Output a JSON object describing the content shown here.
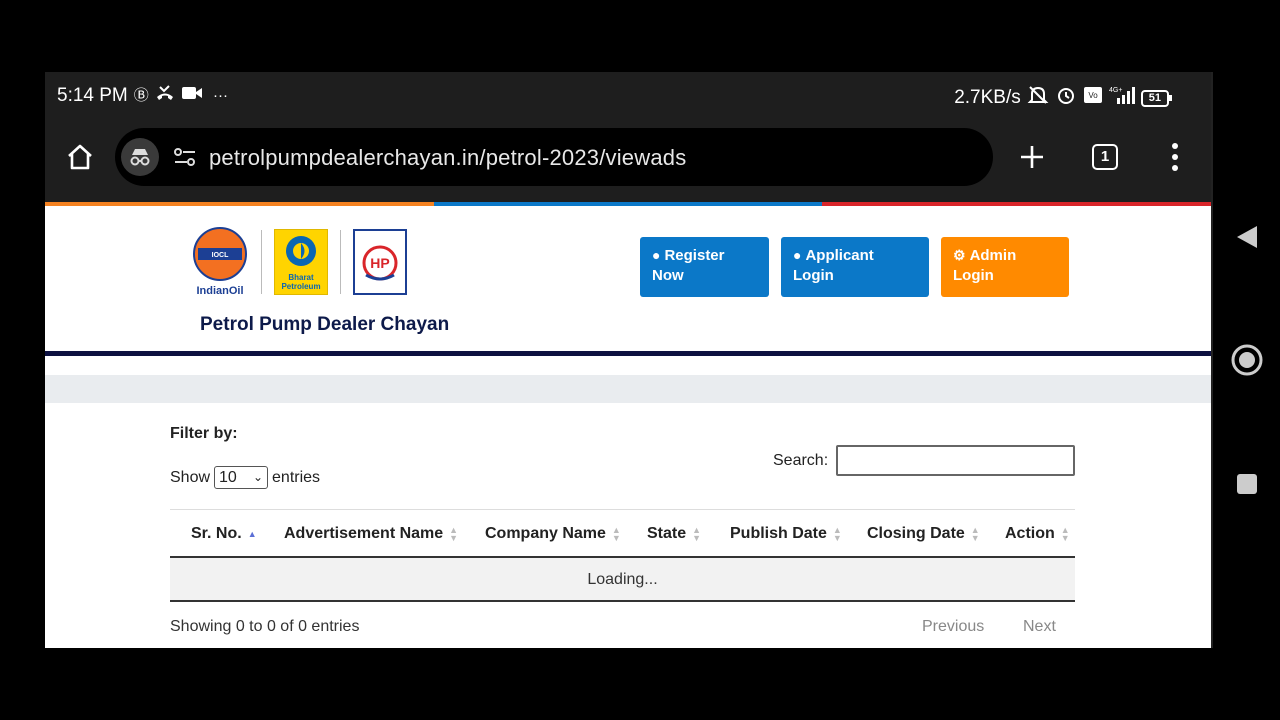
{
  "status_bar": {
    "time": "5:14 PM",
    "network_speed": "2.7KB/s",
    "battery": "51",
    "icons_left": [
      "b-circle-icon",
      "missed-call-icon",
      "video-icon",
      "more-dots-icon"
    ],
    "icons_right": [
      "mute-icon",
      "alarm-icon",
      "volte-icon",
      "signal-4g-icon",
      "battery-icon"
    ]
  },
  "browser": {
    "url": "petrolpumpdealerchayan.in/petrol-2023/viewads",
    "tab_count": "1"
  },
  "header": {
    "site_title": "Petrol Pump Dealer Chayan",
    "logos": {
      "indianoil_caption": "IndianOil",
      "bharat_line1": "Bharat",
      "bharat_line2": "Petroleum",
      "hp_text": "HP"
    },
    "buttons": [
      {
        "line1": "Register",
        "line2": "Now",
        "color": "#0b78c8"
      },
      {
        "line1": "Applicant",
        "line2": "Login",
        "color": "#0b78c8"
      },
      {
        "line1": "Admin",
        "line2": "Login",
        "color": "#ff8a00"
      }
    ],
    "tricolor": [
      "#f58220",
      "#0b78c8",
      "#d9252a"
    ]
  },
  "filters": {
    "filter_label": "Filter by:",
    "show_label": "Show",
    "entries_label": "entries",
    "page_length": "10",
    "search_label": "Search:",
    "search_value": ""
  },
  "table": {
    "columns": [
      "Sr. No.",
      "Advertisement Name",
      "Company Name",
      "State",
      "Publish Date",
      "Closing Date",
      "Action"
    ],
    "loading_text": "Loading...",
    "info": "Showing 0 to 0 of 0 entries",
    "prev_label": "Previous",
    "next_label": "Next"
  }
}
